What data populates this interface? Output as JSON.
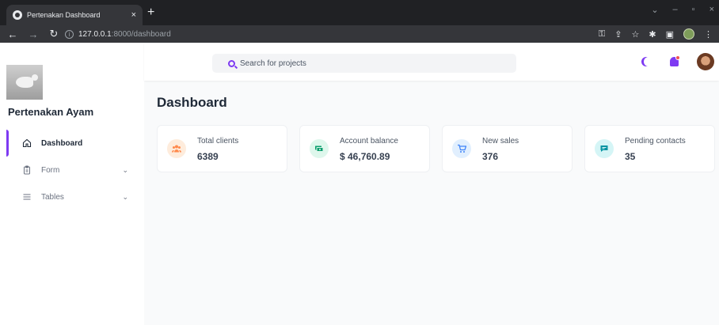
{
  "browser": {
    "tab_title": "Pertenakan Dashboard",
    "tab_close": "×",
    "new_tab": "+",
    "url_host": "127.0.0.1",
    "url_path": ":8000/dashboard"
  },
  "sidebar": {
    "brand": "Pertenakan Ayam",
    "items": [
      {
        "label": "Dashboard",
        "icon": "home-icon",
        "active": true
      },
      {
        "label": "Form",
        "icon": "clipboard-icon",
        "expandable": true
      },
      {
        "label": "Tables",
        "icon": "list-icon",
        "expandable": true
      }
    ],
    "chevron": "⌄"
  },
  "header": {
    "search_placeholder": "Search for projects"
  },
  "main": {
    "title": "Dashboard",
    "cards": [
      {
        "label": "Total clients",
        "value": "6389",
        "icon": "users-icon",
        "color": "#ff8a4c",
        "bg": "#feecdc"
      },
      {
        "label": "Account balance",
        "value": "$ 46,760.89",
        "icon": "cash-icon",
        "color": "#0e9f6e",
        "bg": "#def7ec"
      },
      {
        "label": "New sales",
        "value": "376",
        "icon": "cart-icon",
        "color": "#3f83f8",
        "bg": "#e1effe"
      },
      {
        "label": "Pending contacts",
        "value": "35",
        "icon": "chat-icon",
        "color": "#0694a2",
        "bg": "#d5f5f6"
      }
    ]
  },
  "colors": {
    "accent": "#7e3af2",
    "notification": "#f05252"
  }
}
